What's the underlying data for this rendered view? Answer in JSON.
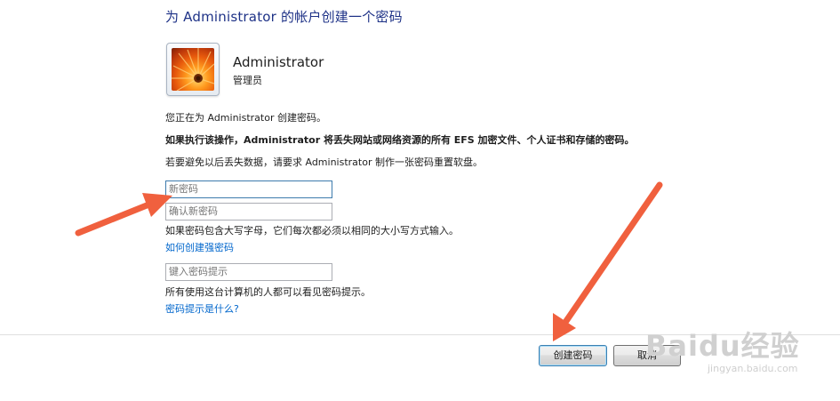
{
  "header": {
    "title": "为 Administrator 的帐户创建一个密码"
  },
  "user": {
    "name": "Administrator",
    "role": "管理员",
    "picture_icon": "flower-user-picture"
  },
  "info": {
    "line1": "您正在为 Administrator 创建密码。",
    "warning": "如果执行该操作，Administrator 将丢失网站或网络资源的所有 EFS 加密文件、个人证书和存储的密码。",
    "line3": "若要避免以后丢失数据，请要求 Administrator 制作一张密码重置软盘。"
  },
  "form": {
    "new_password_placeholder": "新密码",
    "confirm_password_placeholder": "确认新密码",
    "case_note": "如果密码包含大写字母，它们每次都必须以相同的大小写方式输入。",
    "strong_password_link": "如何创建强密码",
    "hint_placeholder": "键入密码提示",
    "hint_note": "所有使用这台计算机的人都可以看见密码提示。",
    "hint_link": "密码提示是什么?"
  },
  "buttons": {
    "create": "创建密码",
    "cancel": "取消"
  },
  "watermark": {
    "main": "Baidu经验",
    "sub": "jingyan.baidu.com"
  },
  "colors": {
    "title": "#1e3287",
    "link": "#0066cc",
    "arrow": "#f0603e"
  }
}
